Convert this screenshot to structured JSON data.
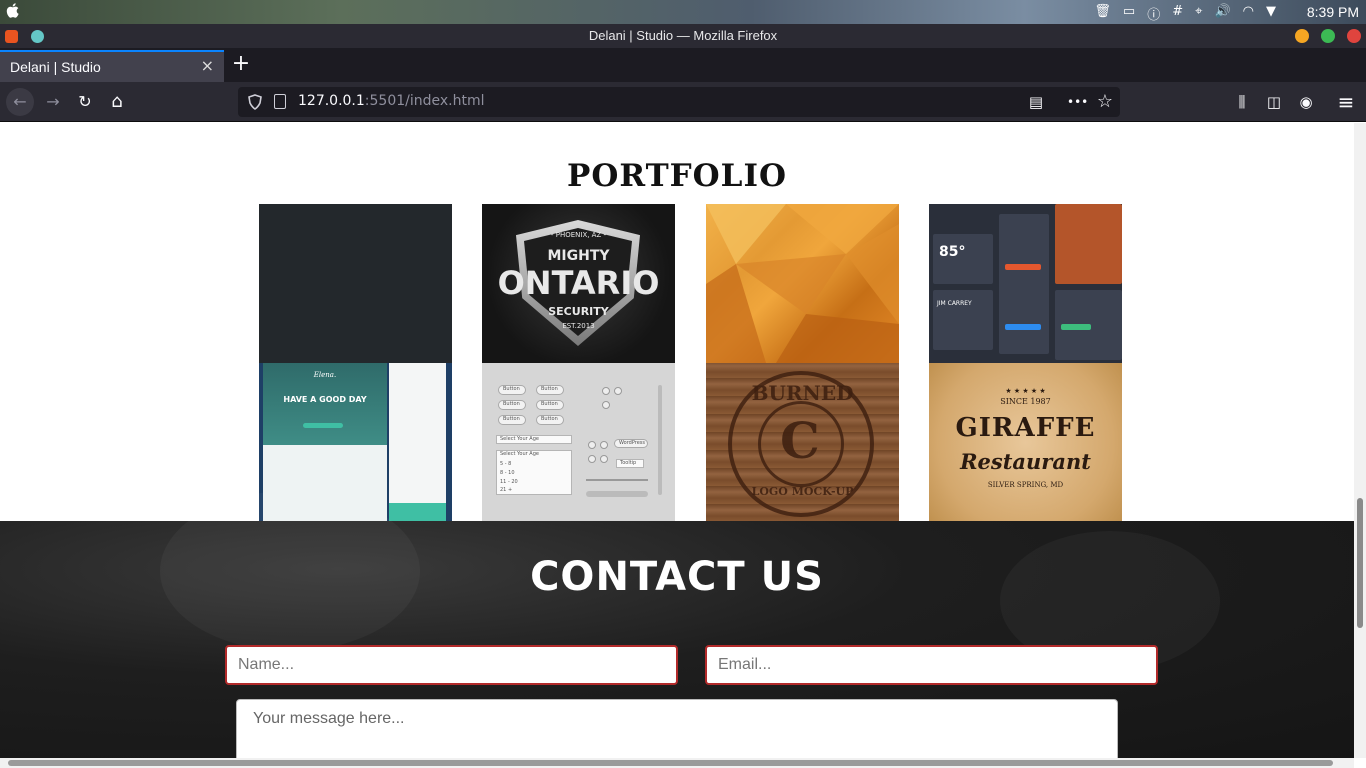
{
  "os_bar": {
    "apple_symbol": "",
    "time": "8:39 PM",
    "tray_icons": [
      "trash-icon",
      "screen-icon",
      "info-icon",
      "slack-icon",
      "location-icon",
      "volume-icon",
      "wifi-icon",
      "dropdown-icon"
    ]
  },
  "window": {
    "title": "Delani | Studio — Mozilla Firefox",
    "controls": {
      "minimize_color": "#f5a623",
      "maximize_color": "#3cba54",
      "close_color": "#e0443e"
    }
  },
  "tabs": [
    {
      "label": "Delani | Studio",
      "active": true
    }
  ],
  "new_tab_symbol": "+",
  "tab_close_symbol": "×",
  "nav": {
    "back_symbol": "←",
    "forward_symbol": "→",
    "reload_symbol": "↻",
    "home_symbol": "⌂",
    "url_host": "127.0.0.1",
    "url_rest": ":5501/index.html",
    "menu_dots": "•••",
    "star_symbol": "☆",
    "hamburger_symbol": "≡"
  },
  "page": {
    "portfolio_title": "PORTFOLIO",
    "tiles": {
      "ontario": {
        "top": "- PHOENIX, AZ -",
        "line1": "MIGHTY",
        "line2": "ONTARIO",
        "line3": "SECURITY",
        "line4": "EST.2013"
      },
      "ui_kit": {
        "temp": "85°",
        "name": "JIM CARREY"
      },
      "website": {
        "headline": "HAVE A GOOD DAY",
        "logo": "Elena."
      },
      "widgets": {
        "btn1": "Button",
        "btn2": "Button",
        "btn3": "Button",
        "btn4": "Button",
        "btn5": "Button",
        "btn6": "Button",
        "select1": "Select Your Age",
        "select2": "Select Your Age",
        "opt1": "5 - 8",
        "opt2": "8 - 10",
        "opt3": "11 - 20",
        "opt4": "21 +",
        "tag": "WordPress",
        "tooltip": "Tooltip"
      },
      "burned": {
        "top": "BURNED",
        "bottom": "LOGO MOCK-UP",
        "mark": "C"
      },
      "giraffe": {
        "stars": "★ ★ ★ ★ ★",
        "since": "SINCE 1987",
        "name": "GIRAFFE",
        "script": "Restaurant",
        "place": "SILVER SPRING, MD"
      }
    },
    "contact_title": "CONTACT US",
    "name_placeholder": "Name...",
    "email_placeholder": "Email...",
    "message_placeholder": "Your message here..."
  },
  "colors": {
    "accent_tab": "#0a84ff",
    "field_border": "#b22a2a",
    "contact_bg": "#1b1b1b"
  }
}
